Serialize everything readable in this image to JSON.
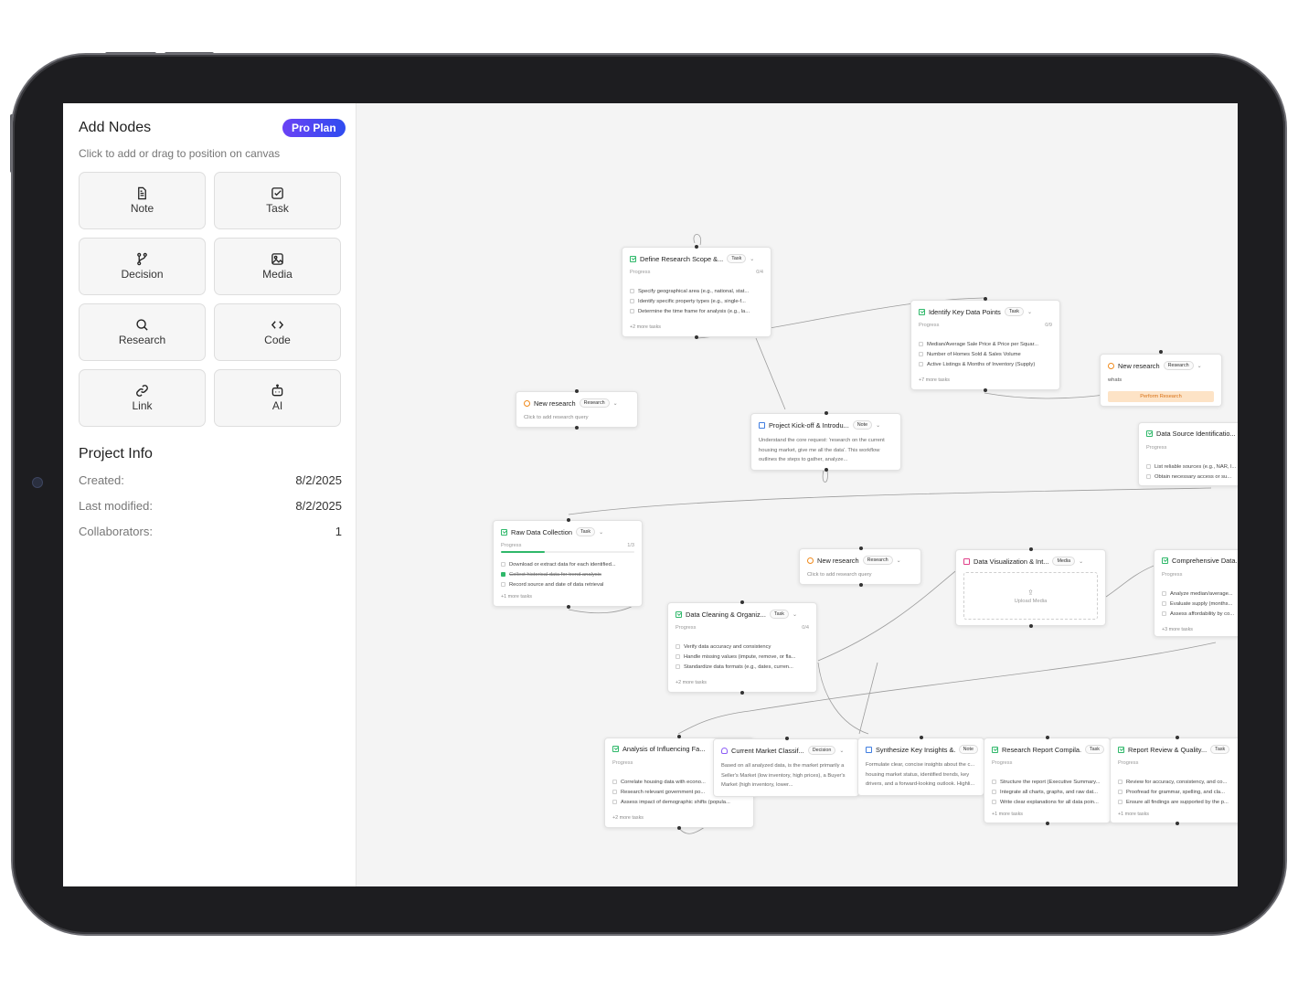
{
  "sidebar": {
    "title": "Add Nodes",
    "plan_badge": "Pro Plan",
    "subtitle": "Click to add or drag to position on canvas",
    "node_types": [
      {
        "label": "Note",
        "icon": "note-icon"
      },
      {
        "label": "Task",
        "icon": "task-icon"
      },
      {
        "label": "Decision",
        "icon": "decision-icon"
      },
      {
        "label": "Media",
        "icon": "media-icon"
      },
      {
        "label": "Research",
        "icon": "search-icon"
      },
      {
        "label": "Code",
        "icon": "code-icon"
      },
      {
        "label": "Link",
        "icon": "link-icon"
      },
      {
        "label": "AI",
        "icon": "robot-icon"
      }
    ],
    "project_info": {
      "title": "Project Info",
      "created_label": "Created:",
      "created": "8/2/2025",
      "modified_label": "Last modified:",
      "modified": "8/2/2025",
      "collaborators_label": "Collaborators:",
      "collaborators": "1"
    }
  },
  "canvas": {
    "progress_label": "Progress",
    "research_placeholder": "Click to add research query",
    "nodes": {
      "define_scope": {
        "title": "Define Research Scope &...",
        "type": "Task",
        "progress": "0/4",
        "tasks": [
          "Specify geographical area (e.g., national, stat...",
          "Identify specific property types (e.g., single-f...",
          "Determine the time frame for analysis (e.g., la..."
        ],
        "more": "+2 more tasks"
      },
      "key_data": {
        "title": "Identify Key Data Points",
        "type": "Task",
        "progress": "0/9",
        "tasks": [
          "Median/Average Sale Price & Price per Squar...",
          "Number of Homes Sold & Sales Volume",
          "Active Listings & Months of Inventory (Supply)"
        ],
        "more": "+7 more tasks"
      },
      "research_right": {
        "title": "New research",
        "type": "Research",
        "query": "whats",
        "action": "Perform Research"
      },
      "research_left": {
        "title": "New research",
        "type": "Research"
      },
      "kickoff": {
        "title": "Project Kick-off & Introdu...",
        "type": "Note",
        "body": "Understand the core request: 'research on the current housing market, give me all the data'. This workflow outlines the steps to gather, analyze..."
      },
      "data_source": {
        "title": "Data Source Identificatio...",
        "type": "Task",
        "tasks": [
          "List reliable sources (e.g., NAR, l...",
          "Obtain necessary access or su..."
        ]
      },
      "raw_data": {
        "title": "Raw Data Collection",
        "type": "Task",
        "progress": "1/3",
        "progress_value": 0.33,
        "tasks": [
          {
            "text": "Download or extract data for each identified...",
            "done": false
          },
          {
            "text": "Collect historical data for trend analysis",
            "done": true
          },
          {
            "text": "Record source and date of data retrieval",
            "done": false
          }
        ],
        "more": "+1 more tasks"
      },
      "research_mid": {
        "title": "New research",
        "type": "Research"
      },
      "data_viz": {
        "title": "Data Visualization & Int...",
        "type": "Media",
        "upload": "Upload Media"
      },
      "comprehensive": {
        "title": "Comprehensive Data...",
        "type": "Task",
        "tasks": [
          "Analyze median/average...",
          "Evaluate supply (months...",
          "Assess affordability by co..."
        ],
        "more": "+3 more tasks"
      },
      "cleaning": {
        "title": "Data Cleaning & Organiz...",
        "type": "Task",
        "progress": "0/4",
        "tasks": [
          "Verify data accuracy and consistency",
          "Handle missing values (impute, remove, or fla...",
          "Standardize data formats (e.g., dates, curren..."
        ],
        "more": "+2 more tasks"
      },
      "influencing": {
        "title": "Analysis of Influencing Fa...",
        "type": "Task",
        "tasks": [
          "Correlate housing data with econo...",
          "Research relevant government po...",
          "Assess impact of demographic shifts (popula..."
        ],
        "more": "+2 more tasks"
      },
      "classification": {
        "title": "Current Market Classif...",
        "type": "Decision",
        "body": "Based on all analyzed data, is the market primarily a Seller's Market (low inventory, high prices), a Buyer's Market (high inventory, lower..."
      },
      "insights": {
        "title": "Synthesize Key Insights &...",
        "type": "Note",
        "body": "Formulate clear, concise insights about the c... housing market status, identified trends, key drivers, and a forward-looking outlook. Highli..."
      },
      "report": {
        "title": "Research Report Compila...",
        "type": "Task",
        "tasks": [
          "Structure the report (Executive Summary...",
          "Integrate all charts, graphs, and raw dat...",
          "Write clear explanations for all data poin..."
        ],
        "more": "+1 more tasks"
      },
      "review": {
        "title": "Report Review & Quality...",
        "type": "Task",
        "tasks": [
          "Review for accuracy, consistency, and co...",
          "Proofread for grammar, spelling, and cla...",
          "Ensure all findings are supported by the p..."
        ],
        "more": "+1 more tasks"
      }
    }
  },
  "colors": {
    "accent_start": "#6a42f5",
    "accent_end": "#2f4cf0",
    "task_green": "#2fb86a",
    "research_orange": "#f08a1c",
    "note_blue": "#3f7de0",
    "decision_purple": "#8b5cf6",
    "media_pink": "#e0408a"
  }
}
